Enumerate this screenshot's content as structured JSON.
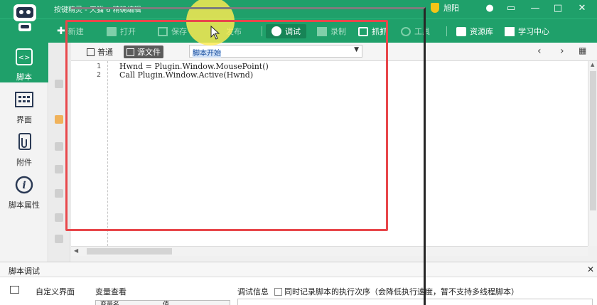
{
  "titlebar": {
    "app_title": "按键精灵 - 天猫 6 精确编辑",
    "username": "旭阳",
    "buttons": [
      "●",
      "▭",
      "—",
      "□",
      "✕"
    ]
  },
  "toolbar": {
    "new_label": "新建",
    "open_label": "打开",
    "save_label": "保存",
    "publish_label": "发布",
    "debug_label": "调试",
    "record_label": "录制",
    "capture_label": "抓抓",
    "tools_label": "工具",
    "library_label": "资源库",
    "learning_label": "学习中心"
  },
  "sidebar": {
    "items": [
      {
        "label": "脚本"
      },
      {
        "label": "界面"
      },
      {
        "label": "附件"
      },
      {
        "label": "脚本属性"
      }
    ]
  },
  "editor_bar": {
    "normal_tab": "普通",
    "source_tab": "源文件",
    "function_select": "脚本开始"
  },
  "editor": {
    "lines": [
      {
        "num": "1",
        "code": "Hwnd = Plugin.Window.MousePoint()"
      },
      {
        "num": "2",
        "code": "Call Plugin.Window.Active(Hwnd)"
      }
    ]
  },
  "debug_panel": {
    "title": "脚本调试",
    "custom_ui_label": "自定义界面",
    "var_watch_label": "变量查看",
    "var_col_name": "变量名",
    "var_col_value": "值",
    "debug_info_label": "调试信息",
    "record_order_label": "同时记录脚本的执行次序（会降低执行速度，暂不支持多线程脚本）"
  },
  "colors": {
    "brand_green": "#1fa06a",
    "highlight_red": "#e8474b",
    "cursor_halo": "#ffec50"
  }
}
